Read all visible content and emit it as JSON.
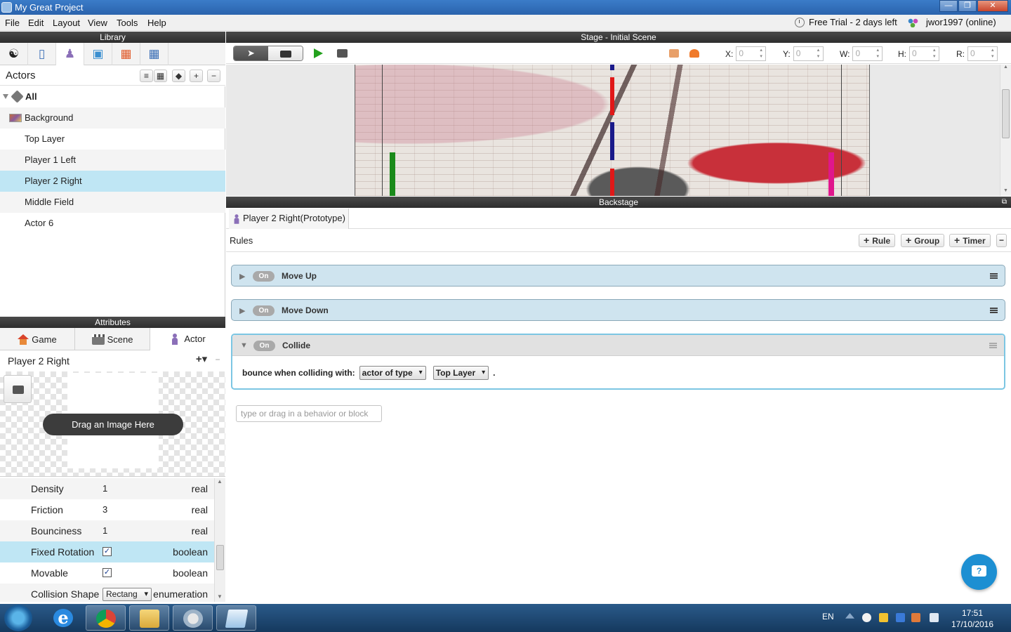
{
  "window": {
    "title": "My Great Project",
    "controls": [
      "minimize",
      "maximize",
      "close"
    ]
  },
  "menu": {
    "items": [
      "File",
      "Edit",
      "Layout",
      "View",
      "Tools",
      "Help"
    ],
    "trial": "Free Trial - 2 days left",
    "user": "jwor1997 (online)"
  },
  "library": {
    "header": "Library",
    "tabs": [
      "scenes-icon",
      "layers-icon",
      "actors-icon",
      "images-icon",
      "behaviors-icon",
      "tables-icon"
    ],
    "actors_title": "Actors",
    "actors": [
      {
        "label": "All",
        "kind": "tag"
      },
      {
        "label": "Background",
        "kind": "image"
      },
      {
        "label": "Top Layer"
      },
      {
        "label": "Player 1 Left"
      },
      {
        "label": "Player 2 Right",
        "selected": true
      },
      {
        "label": "Middle Field"
      },
      {
        "label": "Actor 6"
      }
    ]
  },
  "attributes": {
    "header": "Attributes",
    "tabs": [
      "Game",
      "Scene",
      "Actor"
    ],
    "active_tab": "Actor",
    "actor_name": "Player 2 Right",
    "drag_image": "Drag an Image Here",
    "properties": [
      {
        "name": "Density",
        "value": "1",
        "type": "real"
      },
      {
        "name": "Friction",
        "value": "3",
        "type": "real"
      },
      {
        "name": "Bounciness",
        "value": "1",
        "type": "real"
      },
      {
        "name": "Fixed Rotation",
        "value": "true",
        "type": "boolean",
        "selected": true
      },
      {
        "name": "Movable",
        "value": "true",
        "type": "boolean"
      },
      {
        "name": "Collision Shape",
        "value": "Rectang",
        "type": "enumeration"
      }
    ]
  },
  "stage": {
    "header": "Stage - Initial Scene",
    "coords": [
      {
        "label": "X:",
        "value": "0"
      },
      {
        "label": "Y:",
        "value": "0"
      },
      {
        "label": "W:",
        "value": "0"
      },
      {
        "label": "H:",
        "value": "0"
      },
      {
        "label": "R:",
        "value": "0"
      }
    ],
    "paddle_colors": {
      "left": "#1a8a1a",
      "right": "#e0168c",
      "middle_red": "#e01818",
      "middle_blue": "#1a1a8a"
    }
  },
  "backstage": {
    "header": "Backstage",
    "tab": "Player 2 Right(Prototype)",
    "rules_label": "Rules",
    "buttons": {
      "rule": "Rule",
      "group": "Group",
      "timer": "Timer"
    },
    "rules": [
      {
        "name": "Move Up",
        "state": "On",
        "expanded": false
      },
      {
        "name": "Move Down",
        "state": "On",
        "expanded": false
      },
      {
        "name": "Collide",
        "state": "On",
        "expanded": true
      }
    ],
    "collide_behavior": {
      "text": "bounce when colliding with:",
      "select1": "actor of type",
      "select2": "Top Layer",
      "end": "."
    },
    "behavior_placeholder": "type or drag in a behavior or block",
    "help_glyph": "?"
  },
  "taskbar": {
    "apps": [
      "Internet Explorer",
      "Chrome",
      "File Explorer",
      "Stencyl",
      "Notepad"
    ],
    "lang": "EN",
    "time": "17:51",
    "date": "17/10/2016"
  }
}
